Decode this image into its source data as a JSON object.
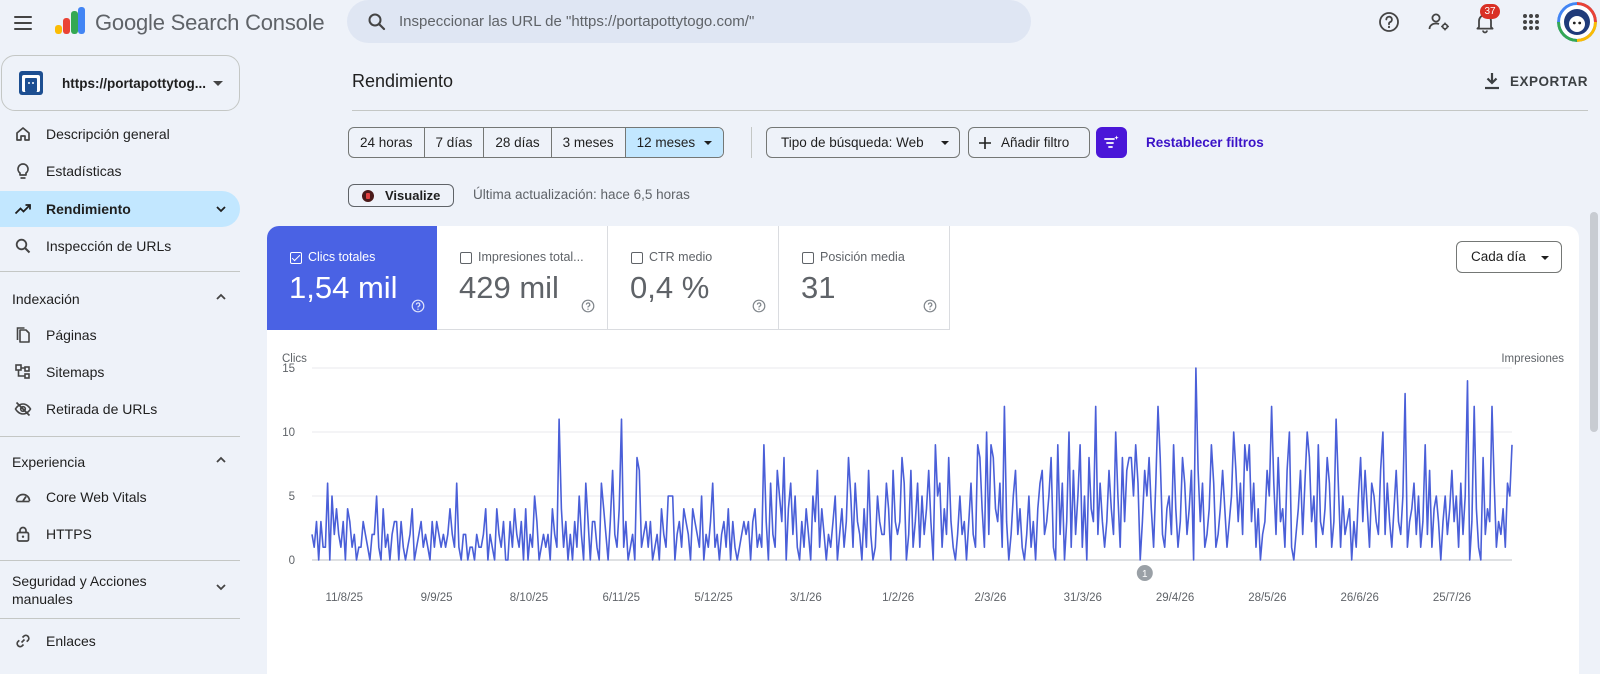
{
  "app": {
    "brand": "Google Search Console"
  },
  "search": {
    "placeholder": "Inspeccionar las URL de \"https://portapottytogo.com/\""
  },
  "topbar": {
    "notification_count": "37"
  },
  "property": {
    "label": "https://portapottytog..."
  },
  "sidebar": {
    "items": [
      {
        "label": "Descripción general",
        "icon": "home-icon"
      },
      {
        "label": "Estadísticas",
        "icon": "lightbulb-icon"
      },
      {
        "label": "Rendimiento",
        "icon": "trending-up-icon",
        "active": true
      },
      {
        "label": "Inspección de URLs",
        "icon": "search-icon"
      }
    ],
    "sections": [
      {
        "label": "Indexación",
        "items": [
          {
            "label": "Páginas",
            "icon": "pages-icon"
          },
          {
            "label": "Sitemaps",
            "icon": "sitemap-icon"
          },
          {
            "label": "Retirada de URLs",
            "icon": "visibility-off-icon"
          }
        ]
      },
      {
        "label": "Experiencia",
        "items": [
          {
            "label": "Core Web Vitals",
            "icon": "gauge-icon"
          },
          {
            "label": "HTTPS",
            "icon": "lock-icon"
          }
        ]
      },
      {
        "label": "Seguridad y Acciones manuales",
        "items": []
      }
    ],
    "bottom_items": [
      {
        "label": "Enlaces",
        "icon": "link-icon"
      }
    ]
  },
  "main": {
    "title": "Rendimiento",
    "export_label": "EXPORTAR",
    "date_ranges": [
      "24 horas",
      "7 días",
      "28 días",
      "3 meses",
      "12 meses"
    ],
    "selected_range": "12 meses",
    "search_type": "Tipo de búsqueda: Web",
    "add_filter": "Añadir filtro",
    "reset_filters": "Restablecer filtros",
    "visualize": "Visualize",
    "last_update": "Última actualización: hace 6,5 horas",
    "granularity": "Cada día"
  },
  "metrics": [
    {
      "label": "Clics totales",
      "value": "1,54 mil",
      "checked": true
    },
    {
      "label": "Impresiones total...",
      "value": "429 mil",
      "checked": false
    },
    {
      "label": "CTR medio",
      "value": "0,4 %",
      "checked": false
    },
    {
      "label": "Posición media",
      "value": "31",
      "checked": false
    }
  ],
  "colors": {
    "clicks_line": "#4a5fd8",
    "active_metric": "#4a62e4",
    "accent": "#3b13c8"
  },
  "chart_data": {
    "type": "line",
    "ylabel": "Clics",
    "y2label": "Impresiones",
    "ylim": [
      0,
      15
    ],
    "yticks": [
      0,
      5,
      10,
      15
    ],
    "xticks": [
      "11/8/25",
      "9/9/25",
      "8/10/25",
      "6/11/25",
      "5/12/25",
      "3/1/26",
      "1/2/26",
      "2/3/26",
      "31/3/26",
      "29/4/26",
      "28/5/26",
      "26/6/26",
      "25/7/26"
    ],
    "annotation": {
      "label": "1",
      "date": "14/4/26"
    },
    "series": [
      {
        "values": [
          2,
          1,
          3,
          0,
          3,
          1,
          1,
          6,
          0,
          5,
          2,
          4,
          2,
          1,
          3,
          0,
          4,
          3,
          1,
          2,
          0,
          1,
          1,
          3,
          2,
          1,
          0,
          2,
          2,
          5,
          1,
          0,
          4,
          1,
          2,
          0,
          2,
          3,
          3,
          0,
          3,
          1,
          0,
          1,
          2,
          4,
          0,
          1,
          2,
          3,
          1,
          2,
          1,
          0,
          3,
          1,
          3,
          2,
          1,
          2,
          1,
          2,
          4,
          2,
          1,
          6,
          1,
          0,
          2,
          2,
          0,
          1,
          1,
          0,
          2,
          1,
          1,
          2,
          4,
          0,
          2,
          1,
          0,
          4,
          2,
          1,
          3,
          0,
          0,
          3,
          1,
          4,
          2,
          1,
          3,
          0,
          4,
          0,
          2,
          1,
          5,
          3,
          0,
          1,
          2,
          1,
          2,
          0,
          4,
          2,
          1,
          11,
          4,
          1,
          3,
          0,
          2,
          0,
          3,
          1,
          5,
          2,
          0,
          6,
          3,
          0,
          3,
          3,
          1,
          0,
          6,
          4,
          2,
          0,
          3,
          7,
          2,
          1,
          4,
          11,
          1,
          3,
          0,
          1,
          2,
          0,
          8,
          7,
          1,
          2,
          3,
          1,
          3,
          0,
          1,
          2,
          0,
          4,
          2,
          1,
          5,
          5,
          5,
          0,
          2,
          3,
          1,
          4,
          3,
          2,
          0,
          4,
          3,
          2,
          1,
          5,
          0,
          2,
          1,
          3,
          6,
          1,
          2,
          0,
          2,
          3,
          1,
          4,
          0,
          3,
          1,
          0,
          1,
          2,
          3,
          2,
          3,
          0,
          3,
          4,
          1,
          2,
          1,
          9,
          3,
          0,
          6,
          2,
          1,
          7,
          5,
          3,
          8,
          0,
          4,
          6,
          2,
          5,
          1,
          0,
          3,
          1,
          4,
          2,
          0,
          5,
          3,
          7,
          1,
          4,
          2,
          0,
          2,
          1,
          3,
          5,
          0,
          2,
          4,
          1,
          3,
          8,
          5,
          1,
          6,
          3,
          2,
          0,
          4,
          1,
          7,
          2,
          0,
          1,
          5,
          3,
          2,
          2,
          6,
          4,
          0,
          7,
          3,
          2,
          3,
          8,
          6,
          0,
          2,
          7,
          1,
          3,
          6,
          1,
          5,
          2,
          4,
          7,
          3,
          0,
          9,
          5,
          6,
          1,
          4,
          2,
          8,
          3,
          1,
          0,
          2,
          5,
          2,
          3,
          0,
          3,
          6,
          2,
          1,
          9,
          8,
          4,
          1,
          10,
          2,
          9,
          8,
          4,
          3,
          6,
          1,
          12,
          3,
          0,
          2,
          5,
          7,
          2,
          4,
          1,
          0,
          2,
          5,
          1,
          3,
          0,
          4,
          6,
          7,
          2,
          3,
          5,
          8,
          1,
          0,
          9,
          2,
          6,
          0,
          3,
          10,
          1,
          7,
          2,
          5,
          9,
          1,
          5,
          0,
          8,
          4,
          3,
          12,
          2,
          6,
          3,
          1,
          3,
          7,
          4,
          2,
          10,
          5,
          1,
          8,
          3,
          7,
          8,
          8,
          5,
          9,
          6,
          0,
          3,
          7,
          5,
          8,
          4,
          1,
          6,
          12,
          8,
          2,
          1,
          4,
          5,
          2,
          9,
          4,
          1,
          3,
          8,
          6,
          2,
          4,
          7,
          0,
          15,
          7,
          3,
          6,
          1,
          2,
          4,
          9,
          6,
          1,
          2,
          4,
          7,
          4,
          1,
          3,
          5,
          10,
          7,
          3,
          6,
          2,
          9,
          7,
          9,
          3,
          6,
          1,
          4,
          0,
          2,
          3,
          7,
          5,
          12,
          6,
          2,
          8,
          3,
          4,
          1,
          7,
          10,
          1,
          0,
          2,
          4,
          7,
          2,
          6,
          10,
          8,
          3,
          5,
          1,
          9,
          3,
          2,
          4,
          8,
          6,
          1,
          3,
          11,
          6,
          1,
          5,
          2,
          3,
          4,
          0,
          3,
          1,
          5,
          8,
          3,
          7,
          4,
          1,
          6,
          5,
          3,
          2,
          7,
          10,
          2,
          6,
          3,
          1,
          4,
          7,
          3,
          2,
          5,
          13,
          1,
          3,
          4,
          6,
          2,
          5,
          1,
          3,
          9,
          2,
          7,
          1,
          4,
          5,
          3,
          0,
          3,
          5,
          2,
          4,
          7,
          3,
          5,
          1,
          6,
          2,
          5,
          14,
          0,
          3,
          12,
          4,
          1,
          0,
          8,
          2,
          4,
          3,
          12,
          6,
          1,
          3,
          2,
          4,
          1,
          6,
          5,
          9
        ]
      }
    ]
  }
}
